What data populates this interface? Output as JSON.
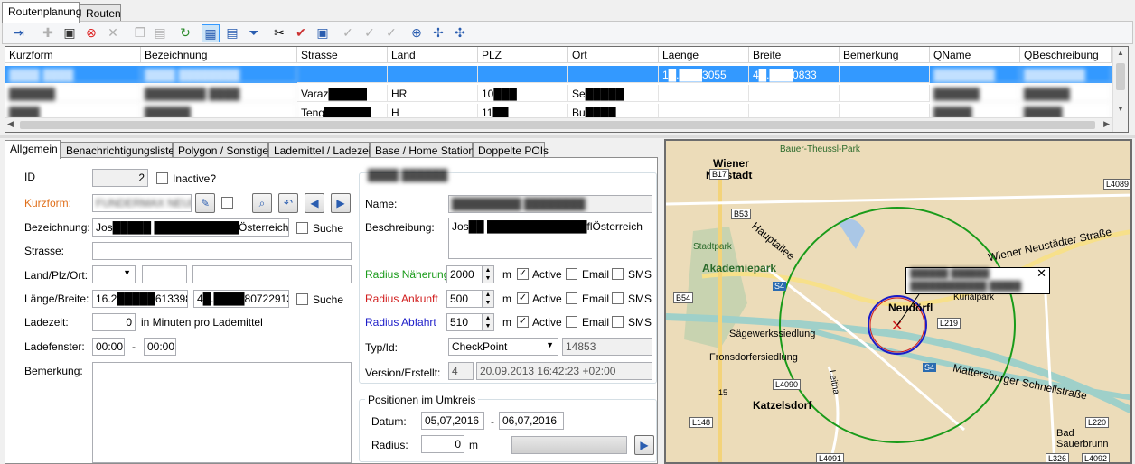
{
  "top_tabs": [
    "Routenplanung",
    "Routen"
  ],
  "grid": {
    "columns": [
      "Kurzform",
      "Bezeichnung",
      "Strasse",
      "Land",
      "PLZ",
      "Ort",
      "Laenge",
      "Breite",
      "Bemerkung",
      "QName",
      "QBeschreibung"
    ],
    "rows": [
      {
        "kurzform": "████ ████",
        "bezeichnung": "████ ████████",
        "strasse": "",
        "land": "",
        "plz": "",
        "ort": "",
        "laenge": "1█.███3055",
        "breite": "4█.███0833",
        "bemerkung": "",
        "qname": "████████",
        "qbeschreibung": "████████"
      },
      {
        "kurzform": "██████",
        "bezeichnung": "████████ ████",
        "strasse": "Varaz█████",
        "land": "HR",
        "plz": "10███",
        "ort": "Se█████",
        "laenge": "",
        "breite": "",
        "bemerkung": "",
        "qname": "██████",
        "qbeschreibung": "██████"
      },
      {
        "kurzform": "████",
        "bezeichnung": "██████",
        "strasse": "Teng██████",
        "land": "H",
        "plz": "11██",
        "ort": "Bu████",
        "laenge": "",
        "breite": "",
        "bemerkung": "",
        "qname": "█████",
        "qbeschreibung": "█████"
      }
    ]
  },
  "detail_tabs": [
    "Allgemein",
    "Benachrichtigungslisten",
    "Polygon / Sonstiges",
    "Lademittel / Ladezeit",
    "Base / Home Stations",
    "Doppelte POIs"
  ],
  "form": {
    "id_label": "ID",
    "id_value": "2",
    "inactive_label": "Inactive?",
    "kurzform_label": "Kurzform:",
    "kurzform_value": "FUNDERMAX NEUD",
    "bezeichnung_label": "Bezeichnung:",
    "bezeichnung_value": "Jos█████ ███████████Österreich",
    "suche_label": "Suche",
    "strasse_label": "Strasse:",
    "strasse_value": "",
    "land_label": "Land/Plz/Ort:",
    "laenge_label": "Länge/Breite:",
    "laenge_value": "16.2█████61339855",
    "breite_value": "4█.████807229131",
    "suche2_label": "Suche",
    "ladezeit_label": "Ladezeit:",
    "ladezeit_value": "0",
    "ladezeit_hint": "in Minuten pro Lademittel",
    "ladefenster_label": "Ladefenster:",
    "ladefenster_from": "00:00",
    "ladefenster_dash": "-",
    "ladefenster_to": "00:00",
    "bemerkung_label": "Bemerkung:"
  },
  "right": {
    "group_title": "████ ██████",
    "name_label": "Name:",
    "name_value": "█████████ ████████",
    "beschreibung_label": "Beschreibung:",
    "beschreibung_value": "Jos██ █████████████flÖsterreich",
    "radius": [
      {
        "label": "Radius Näherung",
        "value": "2000",
        "unit": "m",
        "active": "Active",
        "email": "Email",
        "sms": "SMS",
        "color": "#1a9b1a"
      },
      {
        "label": "Radius Ankunft",
        "value": "500",
        "unit": "m",
        "active": "Active",
        "email": "Email",
        "sms": "SMS",
        "color": "#d11c1c"
      },
      {
        "label": "Radius Abfahrt",
        "value": "510",
        "unit": "m",
        "active": "Active",
        "email": "Email",
        "sms": "SMS",
        "color": "#1c1cc8"
      }
    ],
    "typ_label": "Typ/Id:",
    "typ_value": "CheckPoint",
    "typ_id": "14853",
    "version_label": "Version/Erstellt:",
    "version_value": "4",
    "erstellt_value": "20.09.2013 16:42:23 +02:00",
    "umkreis_title": "Positionen im Umkreis",
    "datum_label": "Datum:",
    "datum_from": "05,07,2016",
    "datum_dash": "-",
    "datum_to": "06,07,2016",
    "radius_label": "Radius:",
    "radius_value": "0",
    "radius_unit": "m"
  },
  "map": {
    "labels": [
      "Bauer-Theussl-Park",
      "Wiener",
      "Neustadt",
      "Akademiepark",
      "Stadtpark",
      "Hauptallee",
      "Wiener Neustädter Straße",
      "Kurialpark",
      "Neudörfl",
      "Sägewerkssiedlung",
      "Fronsdorfersiedlung",
      "Katzelsdorf",
      "Mattersburger Schnellstraße",
      "Leitha",
      "Bad",
      "Sauerbrunn"
    ],
    "roads": [
      "B17",
      "B53",
      "L4089",
      "B54",
      "S4",
      "L219",
      "S4",
      "L4090",
      "L148",
      "L220",
      "L4091",
      "L326",
      "L4092",
      "15"
    ],
    "popup_text": "██████ ██████",
    "popup_line2": "████████████ █████"
  }
}
